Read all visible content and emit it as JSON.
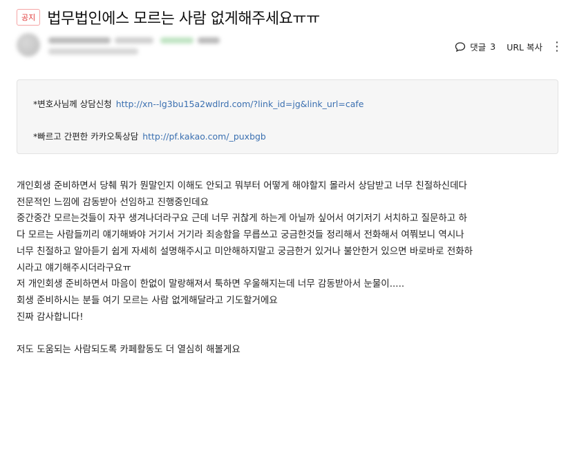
{
  "post": {
    "badge": "공지",
    "title": "법무법인에스 모르는 사람 없게해주세요ㅠㅠ"
  },
  "actions": {
    "comment_label": "댓글",
    "comment_count": "3",
    "url_copy": "URL 복사"
  },
  "quote": {
    "line1_text": "*변호사님께 상담신청",
    "line1_link": "http://xn--lg3bu15a2wdlrd.com/?link_id=jg&link_url=cafe",
    "line2_text": "*빠르고 간편한 카카오톡상담",
    "line2_link": "http://pf.kakao.com/_puxbgb"
  },
  "body": {
    "paragraph1": [
      "개인회생 준비하면서 당췌 뭐가 뭔말인지 이해도 안되고 뭐부터 어떻게 해야할지 몰라서 상담받고 너무 친절하신데다",
      "전문적인 느낌에 감동받아 선임하고 진행중인데요",
      "중간중간 모르는것들이 자꾸 생겨나더라구요 근데 너무 귀찮게 하는게 아닐까 싶어서 여기저기 서치하고 질문하고 하",
      "다 모르는 사람들끼리 얘기해봐야 거기서 거기라 죄송함을 무릅쓰고 궁금한것들 정리해서 전화해서 여쭤보니 역시나",
      "너무 친절하고 알아듣기 쉽게 자세히 설명해주시고 미안해하지말고 궁금한거 있거나 불안한거 있으면 바로바로 전화하",
      "시라고 얘기해주시더라구요ㅠ",
      "저 개인회생 준비하면서 마음이 한없이 말랑해져서 툭하면 우울해지는데 너무 감동받아서 눈물이.....",
      "회생 준비하시는 분들 여기 모르는 사람 없게해달라고 기도할거에요",
      "진짜 감사합니다!"
    ],
    "paragraph2": "저도 도움되는 사람되도록 카페활동도 더 열심히 해볼게요"
  }
}
